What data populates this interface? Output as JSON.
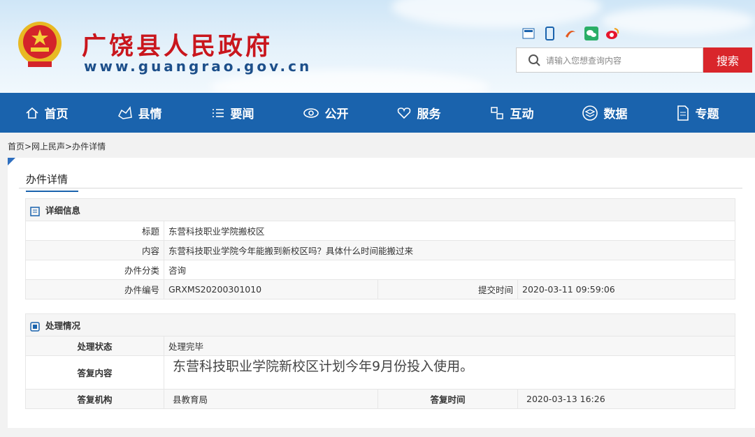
{
  "header": {
    "site_title": "广饶县人民政府",
    "site_url": "www.guangrao.gov.cn",
    "search_placeholder": "请输入您想查询内容",
    "search_button": "搜索"
  },
  "nav": [
    {
      "label": "首页",
      "icon": "home-icon"
    },
    {
      "label": "县情",
      "icon": "map-icon"
    },
    {
      "label": "要闻",
      "icon": "list-icon"
    },
    {
      "label": "公开",
      "icon": "eye-icon"
    },
    {
      "label": "服务",
      "icon": "heart-icon"
    },
    {
      "label": "互动",
      "icon": "interact-icon"
    },
    {
      "label": "数据",
      "icon": "data-icon"
    },
    {
      "label": "专题",
      "icon": "document-icon"
    }
  ],
  "breadcrumb": "首页>网上民声>办件详情",
  "panel": {
    "tab": "办件详情",
    "detail": {
      "heading": "详细信息",
      "title_label": "标题",
      "title_value": "东营科技职业学院搬校区",
      "content_label": "内容",
      "content_value": "东营科技职业学院今年能搬到新校区吗？具体什么时间能搬过来",
      "category_label": "办件分类",
      "category_value": "咨询",
      "number_label": "办件编号",
      "number_value": "GRXMS20200301010",
      "submit_label": "提交时间",
      "submit_value": "2020-03-11 09:59:06"
    },
    "process": {
      "heading": "处理情况",
      "status_label": "处理状态",
      "status_value": "处理完毕",
      "reply_label": "答复内容",
      "reply_value": "东营科技职业学院新校区计划今年9月份投入使用。",
      "org_label": "答复机构",
      "org_value": "县教育局",
      "reply_time_label": "答复时间",
      "reply_time_value": "2020-03-13 16:26"
    }
  },
  "colors": {
    "nav_bg": "#1a63ad",
    "title_red": "#c9161d",
    "search_btn": "#d9262b"
  }
}
